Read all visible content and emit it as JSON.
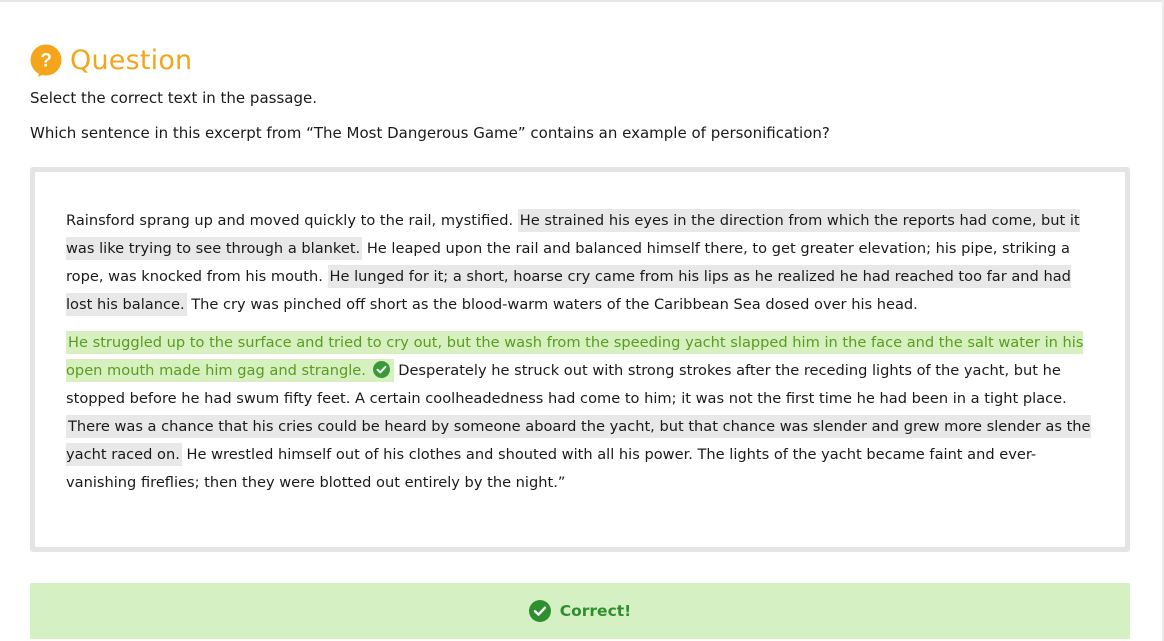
{
  "header": {
    "title": "Question",
    "icon": "question-circle-icon"
  },
  "instruction": "Select the correct text in the passage.",
  "prompt": "Which sentence in this excerpt from “The Most Dangerous Game” contains an example of personification?",
  "passage": {
    "p1": {
      "t1": "Rainsford sprang up and moved quickly to the rail, mystified. ",
      "s1": "He strained his eyes in the direction from which the reports had come, but it was like trying to see through a blanket.",
      "t2": " He leaped upon the rail and balanced himself there, to get greater elevation; his pipe, striking a rope, was knocked from his mouth. ",
      "s2": "He lunged for it; a short, hoarse cry came from his lips as he realized he had reached too far and had lost his balance.",
      "t3": " The cry was pinched off short as the blood-warm waters of the Caribbean Sea dosed over his head."
    },
    "p2": {
      "s3": "He struggled up to the surface and tried to cry out, but the wash from the speeding yacht slapped him in the face and the salt water in his open mouth made him gag and strangle.",
      "t4": " Desperately he struck out with strong strokes after the receding lights of the yacht, but he stopped before he had swum fifty feet. A certain coolheadedness had come to him; it was not the first time he had been in a tight place. ",
      "s4": "There was a chance that his cries could be heard by someone aboard the yacht, but that chance was slender and grew more slender as the yacht raced on.",
      "t5": " He wrestled himself out of his clothes and shouted with all his power. The lights of the yacht became faint and ever-vanishing fireflies; then they were blotted out entirely by the night.”"
    }
  },
  "feedback": {
    "label": "Correct!",
    "icon": "check-circle-icon"
  },
  "colors": {
    "accent": "#f4a51c",
    "selectable_bg": "#e8e8e8",
    "correct_bg": "#d6f0bf",
    "correct_text": "#5a9b22",
    "feedback_bg": "#d5f0c2",
    "feedback_text": "#2f8f2f"
  }
}
